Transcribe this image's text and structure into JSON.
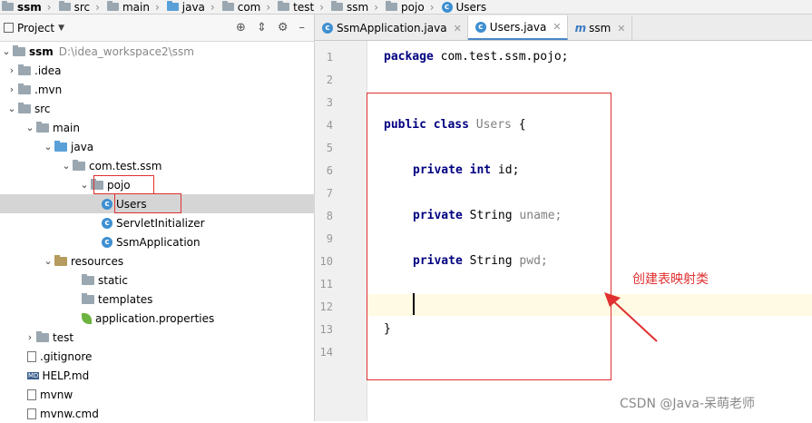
{
  "breadcrumb": [
    {
      "label": "ssm",
      "icon": "project-folder-icon",
      "bold": true
    },
    {
      "label": "src",
      "icon": "folder-icon"
    },
    {
      "label": "main",
      "icon": "folder-icon"
    },
    {
      "label": "java",
      "icon": "source-folder-icon"
    },
    {
      "label": "com",
      "icon": "package-icon"
    },
    {
      "label": "test",
      "icon": "package-icon"
    },
    {
      "label": "ssm",
      "icon": "package-icon"
    },
    {
      "label": "pojo",
      "icon": "package-icon"
    },
    {
      "label": "Users",
      "icon": "class-icon"
    }
  ],
  "project_panel": {
    "title": "Project",
    "tree": [
      {
        "label": "ssm",
        "path": "D:\\idea_workspace2\\ssm"
      },
      {
        "label": ".idea"
      },
      {
        "label": ".mvn"
      },
      {
        "label": "src"
      },
      {
        "label": "main"
      },
      {
        "label": "java"
      },
      {
        "label": "com.test.ssm"
      },
      {
        "label": "pojo"
      },
      {
        "label": "Users"
      },
      {
        "label": "ServletInitializer"
      },
      {
        "label": "SsmApplication"
      },
      {
        "label": "resources"
      },
      {
        "label": "static"
      },
      {
        "label": "templates"
      },
      {
        "label": "application.properties"
      },
      {
        "label": "test"
      },
      {
        "label": ".gitignore"
      },
      {
        "label": "HELP.md"
      },
      {
        "label": "mvnw"
      },
      {
        "label": "mvnw.cmd"
      }
    ]
  },
  "editor_tabs": [
    {
      "label": "SsmApplication.java",
      "icon": "class-icon"
    },
    {
      "label": "Users.java",
      "icon": "class-icon",
      "active": true
    },
    {
      "label": "ssm",
      "icon": "maven-icon"
    }
  ],
  "line_numbers": [
    "1",
    "2",
    "3",
    "4",
    "5",
    "6",
    "7",
    "8",
    "9",
    "10",
    "11",
    "12",
    "13",
    "14"
  ],
  "code": {
    "l1_kw": "package",
    "l1_rest": " com.test.ssm.pojo;",
    "l4_kw": "public class",
    "l4_name": " Users",
    " l4_brace": " {",
    "l6_kw": "private int",
    "l6_rest": " id;",
    "l8_kw": "private",
    "l8_type": " String",
    "l8_rest": " uname;",
    "l10_kw": "private",
    "l10_type": " String",
    "l10_rest": " pwd;",
    "l13": "}"
  },
  "annotation": "创建表映射类",
  "watermark": "CSDN @Java-呆萌老师",
  "colors": {
    "keyword": "#000080",
    "annotation_red": "#e03030",
    "caret_line": "#fffae3"
  }
}
